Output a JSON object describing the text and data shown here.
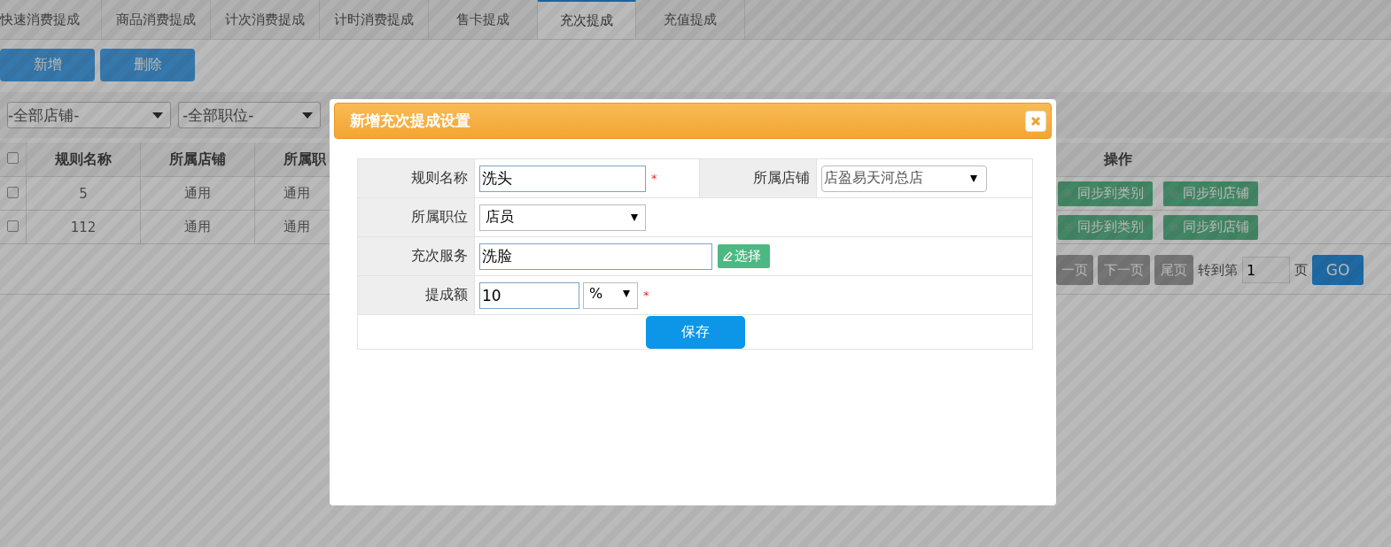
{
  "tabs": [
    {
      "label": "快速消费提成",
      "selected": false
    },
    {
      "label": "商品消费提成",
      "selected": false
    },
    {
      "label": "计次消费提成",
      "selected": false
    },
    {
      "label": "计时消费提成",
      "selected": false
    },
    {
      "label": "售卡提成",
      "selected": false
    },
    {
      "label": "充次提成",
      "selected": true
    },
    {
      "label": "充值提成",
      "selected": false
    }
  ],
  "toolbar": {
    "buttons": [
      "新增",
      "删除"
    ]
  },
  "filters": [
    {
      "value": "-全部店铺-"
    },
    {
      "value": "-全部职位-"
    }
  ],
  "table": {
    "select_all_checked": false,
    "columns": [
      "规则名称",
      "所属店铺",
      "所属职",
      "操作"
    ],
    "rows": [
      {
        "checked": false,
        "cells": [
          "5",
          "通用",
          "通用"
        ],
        "actions": [
          "同步到类别",
          "同步到店铺"
        ]
      },
      {
        "checked": false,
        "cells": [
          "112",
          "通用",
          "通用"
        ],
        "actions": [
          "同步到类别",
          "同步到店铺"
        ]
      }
    ]
  },
  "pager": {
    "buttons": [
      "一页",
      "下一页",
      "尾页"
    ],
    "goto_label": "转到第",
    "page_input": "1",
    "page_suffix": "页",
    "go_button": "GO"
  },
  "dialog": {
    "title": "新增充次提成设置",
    "rows": [
      [
        {
          "label": "规则名称",
          "kind": "text",
          "value": "洗头",
          "required": true,
          "required_mark": "*"
        },
        {
          "label": "所属店铺",
          "kind": "select",
          "value": "店盈易天河总店"
        }
      ],
      [
        {
          "label": "所属职位",
          "kind": "select",
          "value": "店员"
        }
      ],
      [
        {
          "label": "充次服务",
          "kind": "pick",
          "value": "洗脸",
          "button": "选择"
        }
      ],
      [
        {
          "label": "提成额",
          "kind": "amount",
          "value": "10",
          "unit": "%",
          "required": true,
          "required_mark": "*"
        }
      ]
    ],
    "save_button": "保存"
  }
}
